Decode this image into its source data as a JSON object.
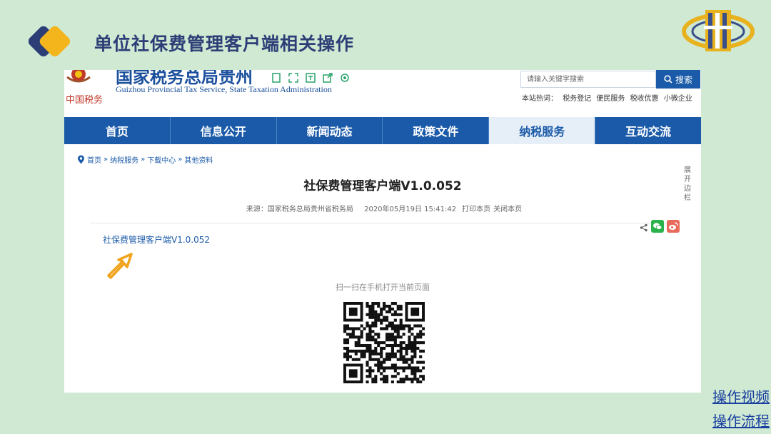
{
  "slide": {
    "title": "单位社保费管理客户端相关操作"
  },
  "site": {
    "name_cn": "国家税务总局贵州",
    "name_en": "Guizhou Provincial Tax Service, State Taxation Administration",
    "emblem_text": "中国税务",
    "search_placeholder": "请输入关键字搜索",
    "search_button": "搜索",
    "hot_label": "本站热词：",
    "hot_words": [
      "税务登记",
      "便民服务",
      "税收优惠",
      "小微企业"
    ]
  },
  "nav": {
    "items": [
      "首页",
      "信息公开",
      "新闻动态",
      "政策文件",
      "纳税服务",
      "互动交流"
    ],
    "active_index": 4
  },
  "breadcrumb": [
    "首页",
    "纳税服务",
    "下载中心",
    "其他资料"
  ],
  "breadcrumb_sep": "»",
  "article": {
    "title": "社保费管理客户端V1.0.052",
    "source": "来源：国家税务总局贵州省税务局",
    "date": "2020年05月19日 15:41:42",
    "print": "打印本页",
    "close": "关闭本页",
    "sidebar_toggle": "展开边栏",
    "download_link": "社保费管理客户端V1.0.052",
    "scan_text": "扫一扫在手机打开当前页面"
  },
  "links": {
    "video": "操作视频",
    "flow": "操作流程"
  },
  "colors": {
    "slide_bg": "#cfe9d2",
    "nav_blue": "#1a5aa8",
    "title_navy": "#2d3e77",
    "accent_orange": "#f0a31c"
  }
}
